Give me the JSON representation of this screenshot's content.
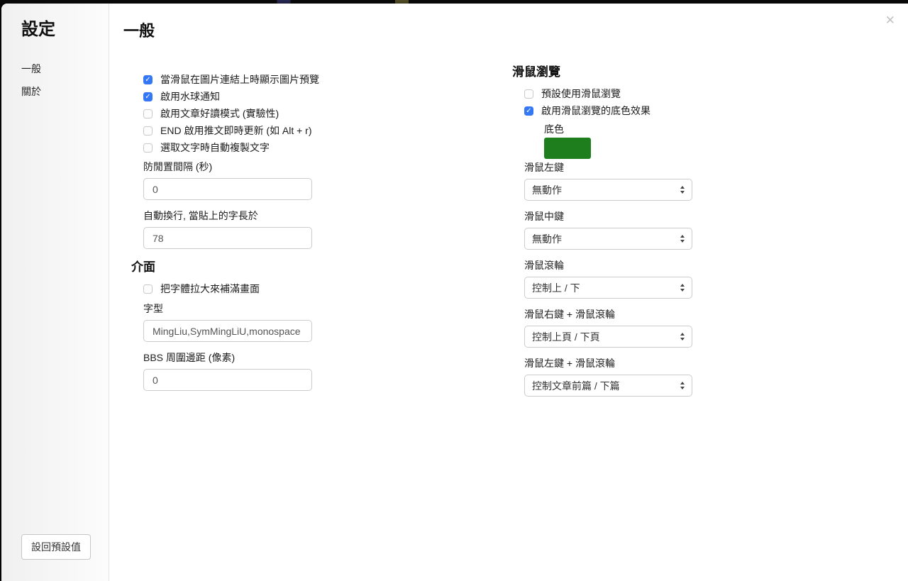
{
  "overlay": {
    "close_icon": "✕"
  },
  "colors": {
    "accent": "#3478f6",
    "page_background": "#0a0a0a"
  },
  "sidebar": {
    "title": "設定",
    "items": [
      {
        "label": "一般",
        "active": true
      },
      {
        "label": "關於",
        "active": false
      }
    ],
    "reset_button": "設回預設值"
  },
  "main": {
    "title": "一般",
    "general": {
      "checkboxes": [
        {
          "label": "當滑鼠在圖片連結上時顯示圖片預覽",
          "checked": true
        },
        {
          "label": "啟用水球通知",
          "checked": true
        },
        {
          "label": "啟用文章好讀模式 (實驗性)",
          "checked": false
        },
        {
          "label": "END 啟用推文即時更新 (如 Alt + r)",
          "checked": false
        },
        {
          "label": "選取文字時自動複製文字",
          "checked": false
        }
      ],
      "fields": [
        {
          "label": "防閒置間隔 (秒)",
          "value": "0"
        },
        {
          "label": "自動換行, 當貼上的字長於",
          "value": "78"
        }
      ]
    },
    "interface": {
      "title": "介面",
      "checkboxes": [
        {
          "label": "把字體拉大來補滿畫面",
          "checked": false
        }
      ],
      "fields": [
        {
          "label": "字型",
          "value": "MingLiu,SymMingLiU,monospace"
        },
        {
          "label": "BBS 周圍邊距 (像素)",
          "value": "0"
        }
      ]
    },
    "mouse": {
      "title": "滑鼠瀏覽",
      "checkboxes": [
        {
          "label": "預設使用滑鼠瀏覽",
          "checked": false
        },
        {
          "label": "啟用滑鼠瀏覽的底色效果",
          "checked": true
        }
      ],
      "color_label": "底色",
      "color_value": "#1e7e1e",
      "selects": [
        {
          "label": "滑鼠左鍵",
          "value": "無動作"
        },
        {
          "label": "滑鼠中鍵",
          "value": "無動作"
        },
        {
          "label": "滑鼠滾輪",
          "value": "控制上 / 下"
        },
        {
          "label": "滑鼠右鍵 + 滑鼠滾輪",
          "value": "控制上頁 / 下頁"
        },
        {
          "label": "滑鼠左鍵 + 滑鼠滾輪",
          "value": "控制文章前篇 / 下篇"
        }
      ]
    }
  }
}
